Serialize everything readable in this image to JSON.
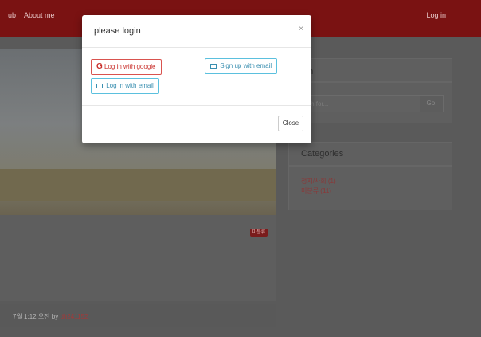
{
  "navbar": {
    "links": [
      "ub",
      "About me"
    ],
    "login_label": "Log in"
  },
  "post": {
    "badge": "미분류",
    "meta_date": "7월 1:12 오전 by ",
    "meta_author": "dh241152"
  },
  "sidebar": {
    "search_title": "rch",
    "search_placeholder": "arch for...",
    "search_button": "Go!",
    "categories_title": "Categories",
    "categories": [
      "정치/사회 (1)",
      "미분류 (11)"
    ]
  },
  "modal": {
    "title": "please login",
    "close_x": "×",
    "google_icon": "G",
    "google_label": "Log in with google",
    "signup_label": "Sign up with email",
    "email_label": "Log in with email",
    "close_button": "Close"
  },
  "colors": {
    "navbar": "#7a1212",
    "danger": "#d9534f",
    "info": "#5bc0de"
  },
  "icons": [
    "google-icon",
    "envelope-icon",
    "close-icon"
  ]
}
